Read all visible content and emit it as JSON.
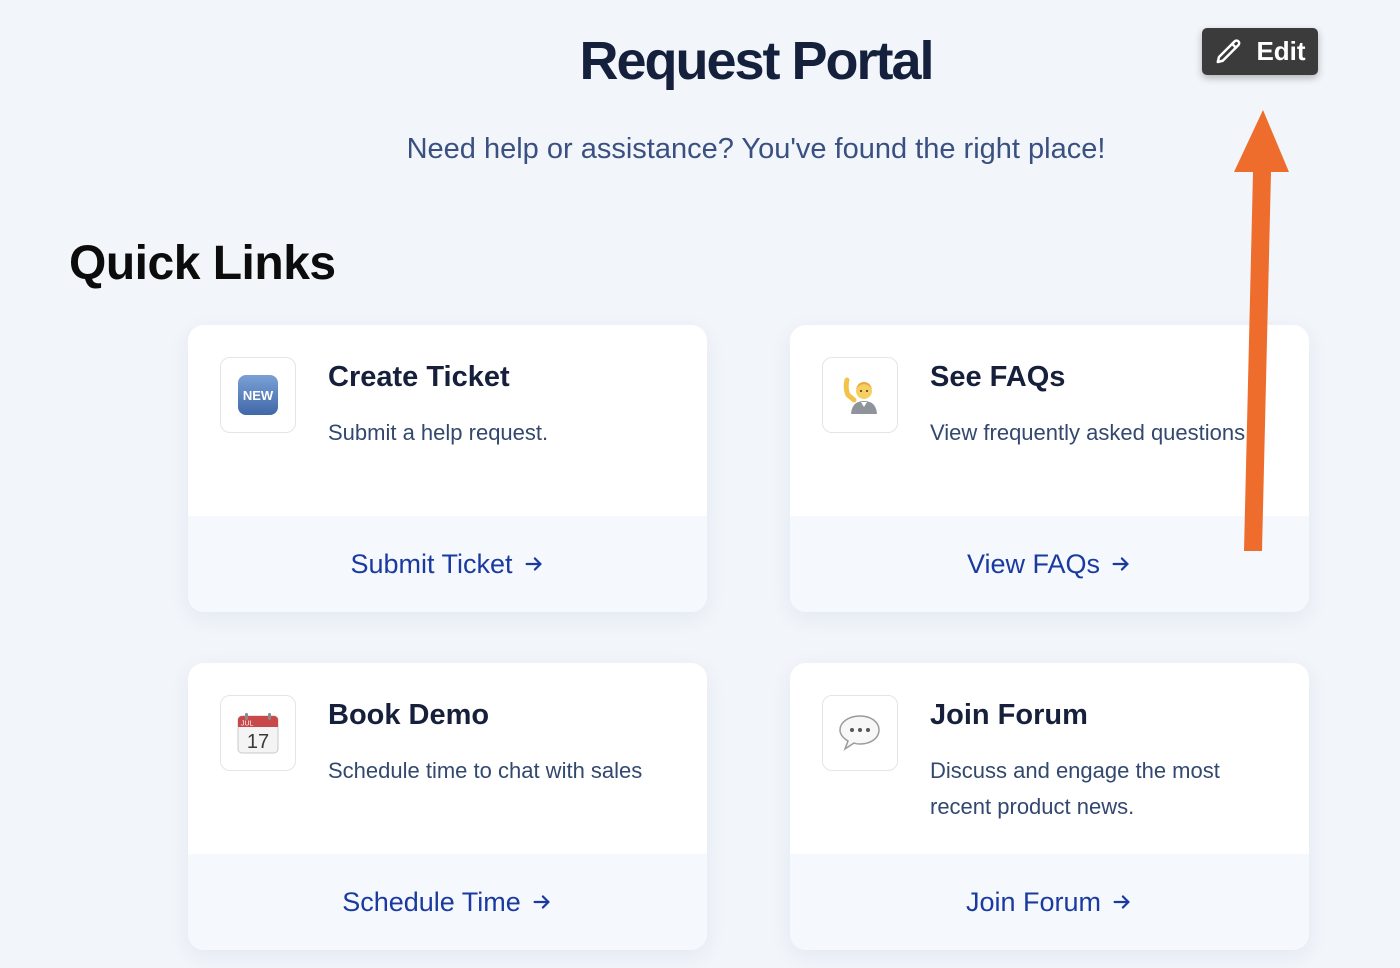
{
  "header": {
    "title": "Request Portal",
    "subtitle": "Need help or assistance? You've found the right place!",
    "edit_label": "Edit"
  },
  "section": {
    "title": "Quick Links"
  },
  "cards": [
    {
      "title": "Create Ticket",
      "description": "Submit a help request.",
      "icon": "new-badge-icon",
      "icon_text": "NEW",
      "action": "Submit Ticket"
    },
    {
      "title": "See FAQs",
      "description": "View frequently asked questions",
      "icon": "person-raising-hand-icon",
      "action": "View FAQs"
    },
    {
      "title": "Book Demo",
      "description": "Schedule time to chat with sales",
      "icon": "calendar-icon",
      "icon_month": "JUL",
      "icon_day": "17",
      "action": "Schedule Time"
    },
    {
      "title": "Join Forum",
      "description": "Discuss and engage the most recent product news.",
      "icon": "speech-bubble-icon",
      "action": "Join Forum"
    }
  ],
  "annotation": {
    "arrow_color": "#ee6d2d"
  }
}
